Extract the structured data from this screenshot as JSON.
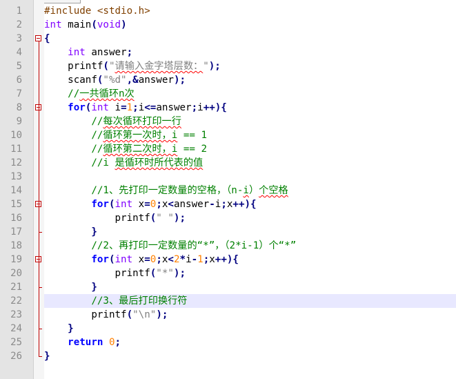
{
  "editor": {
    "current_line": 22,
    "line_numbers": [
      "1",
      "2",
      "3",
      "4",
      "5",
      "6",
      "7",
      "8",
      "9",
      "10",
      "11",
      "12",
      "13",
      "14",
      "15",
      "16",
      "17",
      "18",
      "19",
      "20",
      "21",
      "22",
      "23",
      "24",
      "25",
      "26"
    ],
    "lines": [
      [
        {
          "t": "#include <stdio.h>",
          "c": "pre"
        }
      ],
      [
        {
          "t": "int",
          "c": "type"
        },
        {
          "t": " main",
          "c": "txt"
        },
        {
          "t": "(",
          "c": "op"
        },
        {
          "t": "void",
          "c": "type"
        },
        {
          "t": ")",
          "c": "op"
        }
      ],
      [
        {
          "t": "{",
          "c": "op"
        }
      ],
      [
        {
          "t": "    ",
          "c": "txt"
        },
        {
          "t": "int",
          "c": "type"
        },
        {
          "t": " answer",
          "c": "txt"
        },
        {
          "t": ";",
          "c": "op"
        }
      ],
      [
        {
          "t": "    printf",
          "c": "txt"
        },
        {
          "t": "(",
          "c": "op"
        },
        {
          "t": "\"",
          "c": "str"
        },
        {
          "t": "请输入金字塔层数：",
          "c": "str",
          "sq": true
        },
        {
          "t": "\"",
          "c": "str"
        },
        {
          "t": ");",
          "c": "op"
        }
      ],
      [
        {
          "t": "    scanf",
          "c": "txt"
        },
        {
          "t": "(",
          "c": "op"
        },
        {
          "t": "\"%d\"",
          "c": "str"
        },
        {
          "t": ",&",
          "c": "op"
        },
        {
          "t": "answer",
          "c": "txt"
        },
        {
          "t": ");",
          "c": "op"
        }
      ],
      [
        {
          "t": "    //",
          "c": "com"
        },
        {
          "t": "一共循环n次",
          "c": "com",
          "sq": true
        }
      ],
      [
        {
          "t": "    ",
          "c": "txt"
        },
        {
          "t": "for",
          "c": "kw"
        },
        {
          "t": "(",
          "c": "op"
        },
        {
          "t": "int",
          "c": "type"
        },
        {
          "t": " i",
          "c": "txt"
        },
        {
          "t": "=",
          "c": "op"
        },
        {
          "t": "1",
          "c": "num"
        },
        {
          "t": ";",
          "c": "op"
        },
        {
          "t": "i",
          "c": "txt"
        },
        {
          "t": "<=",
          "c": "op"
        },
        {
          "t": "answer",
          "c": "txt"
        },
        {
          "t": ";",
          "c": "op"
        },
        {
          "t": "i",
          "c": "txt"
        },
        {
          "t": "++){",
          "c": "op"
        }
      ],
      [
        {
          "t": "        //",
          "c": "com"
        },
        {
          "t": "每次循环打印一行",
          "c": "com",
          "sq": true
        }
      ],
      [
        {
          "t": "        //",
          "c": "com"
        },
        {
          "t": "循环第一次时，i",
          "c": "com",
          "sq": true
        },
        {
          "t": " == 1",
          "c": "com"
        }
      ],
      [
        {
          "t": "        //",
          "c": "com"
        },
        {
          "t": "循环第二次时，i",
          "c": "com",
          "sq": true
        },
        {
          "t": " == 2",
          "c": "com"
        }
      ],
      [
        {
          "t": "        //i ",
          "c": "com"
        },
        {
          "t": "是循环时所代表的值",
          "c": "com",
          "sq": true
        }
      ],
      [
        {
          "t": "",
          "c": "txt"
        }
      ],
      [
        {
          "t": "        //1、先打印一定数量的空格，（n-",
          "c": "com"
        },
        {
          "t": "i",
          "c": "com",
          "sq": true
        },
        {
          "t": "）",
          "c": "com"
        },
        {
          "t": "个空格",
          "c": "com",
          "sq": true
        }
      ],
      [
        {
          "t": "        ",
          "c": "txt"
        },
        {
          "t": "for",
          "c": "kw"
        },
        {
          "t": "(",
          "c": "op"
        },
        {
          "t": "int",
          "c": "type"
        },
        {
          "t": " x",
          "c": "txt"
        },
        {
          "t": "=",
          "c": "op"
        },
        {
          "t": "0",
          "c": "num"
        },
        {
          "t": ";",
          "c": "op"
        },
        {
          "t": "x",
          "c": "txt"
        },
        {
          "t": "<",
          "c": "op"
        },
        {
          "t": "answer",
          "c": "txt"
        },
        {
          "t": "-",
          "c": "op"
        },
        {
          "t": "i",
          "c": "txt"
        },
        {
          "t": ";",
          "c": "op"
        },
        {
          "t": "x",
          "c": "txt"
        },
        {
          "t": "++){",
          "c": "op"
        }
      ],
      [
        {
          "t": "            printf",
          "c": "txt"
        },
        {
          "t": "(",
          "c": "op"
        },
        {
          "t": "\" \"",
          "c": "str"
        },
        {
          "t": ");",
          "c": "op"
        }
      ],
      [
        {
          "t": "        }",
          "c": "op"
        }
      ],
      [
        {
          "t": "        //2、再打印一定数量的“*”，（2*i-1）个“*”",
          "c": "com"
        }
      ],
      [
        {
          "t": "        ",
          "c": "txt"
        },
        {
          "t": "for",
          "c": "kw"
        },
        {
          "t": "(",
          "c": "op"
        },
        {
          "t": "int",
          "c": "type"
        },
        {
          "t": " x",
          "c": "txt"
        },
        {
          "t": "=",
          "c": "op"
        },
        {
          "t": "0",
          "c": "num"
        },
        {
          "t": ";",
          "c": "op"
        },
        {
          "t": "x",
          "c": "txt"
        },
        {
          "t": "<",
          "c": "op"
        },
        {
          "t": "2",
          "c": "num"
        },
        {
          "t": "*",
          "c": "op"
        },
        {
          "t": "i",
          "c": "txt"
        },
        {
          "t": "-",
          "c": "op"
        },
        {
          "t": "1",
          "c": "num"
        },
        {
          "t": ";",
          "c": "op"
        },
        {
          "t": "x",
          "c": "txt"
        },
        {
          "t": "++){",
          "c": "op"
        }
      ],
      [
        {
          "t": "            printf",
          "c": "txt"
        },
        {
          "t": "(",
          "c": "op"
        },
        {
          "t": "\"*\"",
          "c": "str"
        },
        {
          "t": ");",
          "c": "op"
        }
      ],
      [
        {
          "t": "        }",
          "c": "op"
        }
      ],
      [
        {
          "t": "        //3、最后打印换行符",
          "c": "com"
        }
      ],
      [
        {
          "t": "        printf",
          "c": "txt"
        },
        {
          "t": "(",
          "c": "op"
        },
        {
          "t": "\"\\n\"",
          "c": "str"
        },
        {
          "t": ");",
          "c": "op"
        }
      ],
      [
        {
          "t": "    }",
          "c": "op"
        }
      ],
      [
        {
          "t": "    ",
          "c": "txt"
        },
        {
          "t": "return",
          "c": "kw"
        },
        {
          "t": " ",
          "c": "txt"
        },
        {
          "t": "0",
          "c": "num"
        },
        {
          "t": ";",
          "c": "op"
        }
      ],
      [
        {
          "t": "}",
          "c": "op"
        }
      ]
    ]
  }
}
